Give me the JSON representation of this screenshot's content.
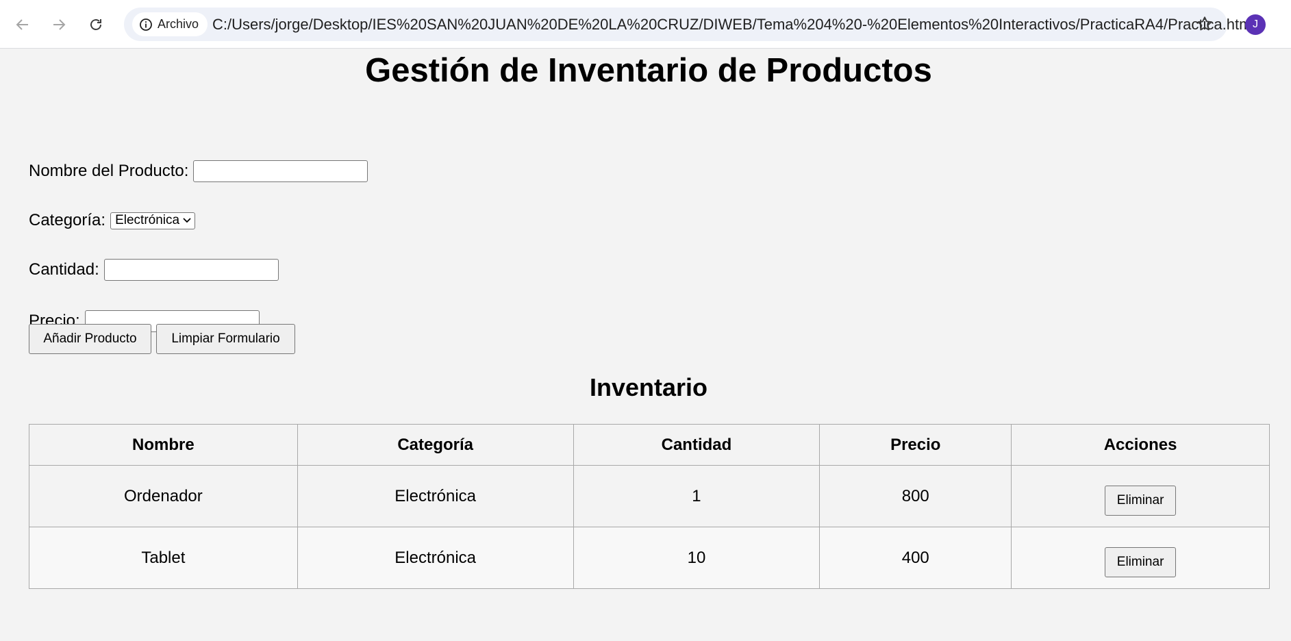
{
  "browser": {
    "site_label": "Archivo",
    "url": "C:/Users/jorge/Desktop/IES%20SAN%20JUAN%20DE%20LA%20CRUZ/DIWEB/Tema%204%20-%20Elementos%20Interactivos/PracticaRA4/Practica.html",
    "avatar_initial": "J",
    "avatar_color": "#5b32b5"
  },
  "page": {
    "title": "Gestión de Inventario de Productos",
    "form": {
      "name_label": "Nombre del Producto:",
      "name_value": "",
      "category_label": "Categoría:",
      "category_selected": "Electrónica",
      "quantity_label": "Cantidad:",
      "quantity_value": "",
      "price_label": "Precio:",
      "price_value": ""
    },
    "buttons": {
      "add": "Añadir Producto",
      "clear": "Limpiar Formulario"
    },
    "inventory_title": "Inventario",
    "table": {
      "headers": [
        "Nombre",
        "Categoría",
        "Cantidad",
        "Precio",
        "Acciones"
      ],
      "rows": [
        {
          "name": "Ordenador",
          "category": "Electrónica",
          "quantity": "1",
          "price": "800",
          "action": "Eliminar"
        },
        {
          "name": "Tablet",
          "category": "Electrónica",
          "quantity": "10",
          "price": "400",
          "action": "Eliminar"
        }
      ]
    }
  }
}
